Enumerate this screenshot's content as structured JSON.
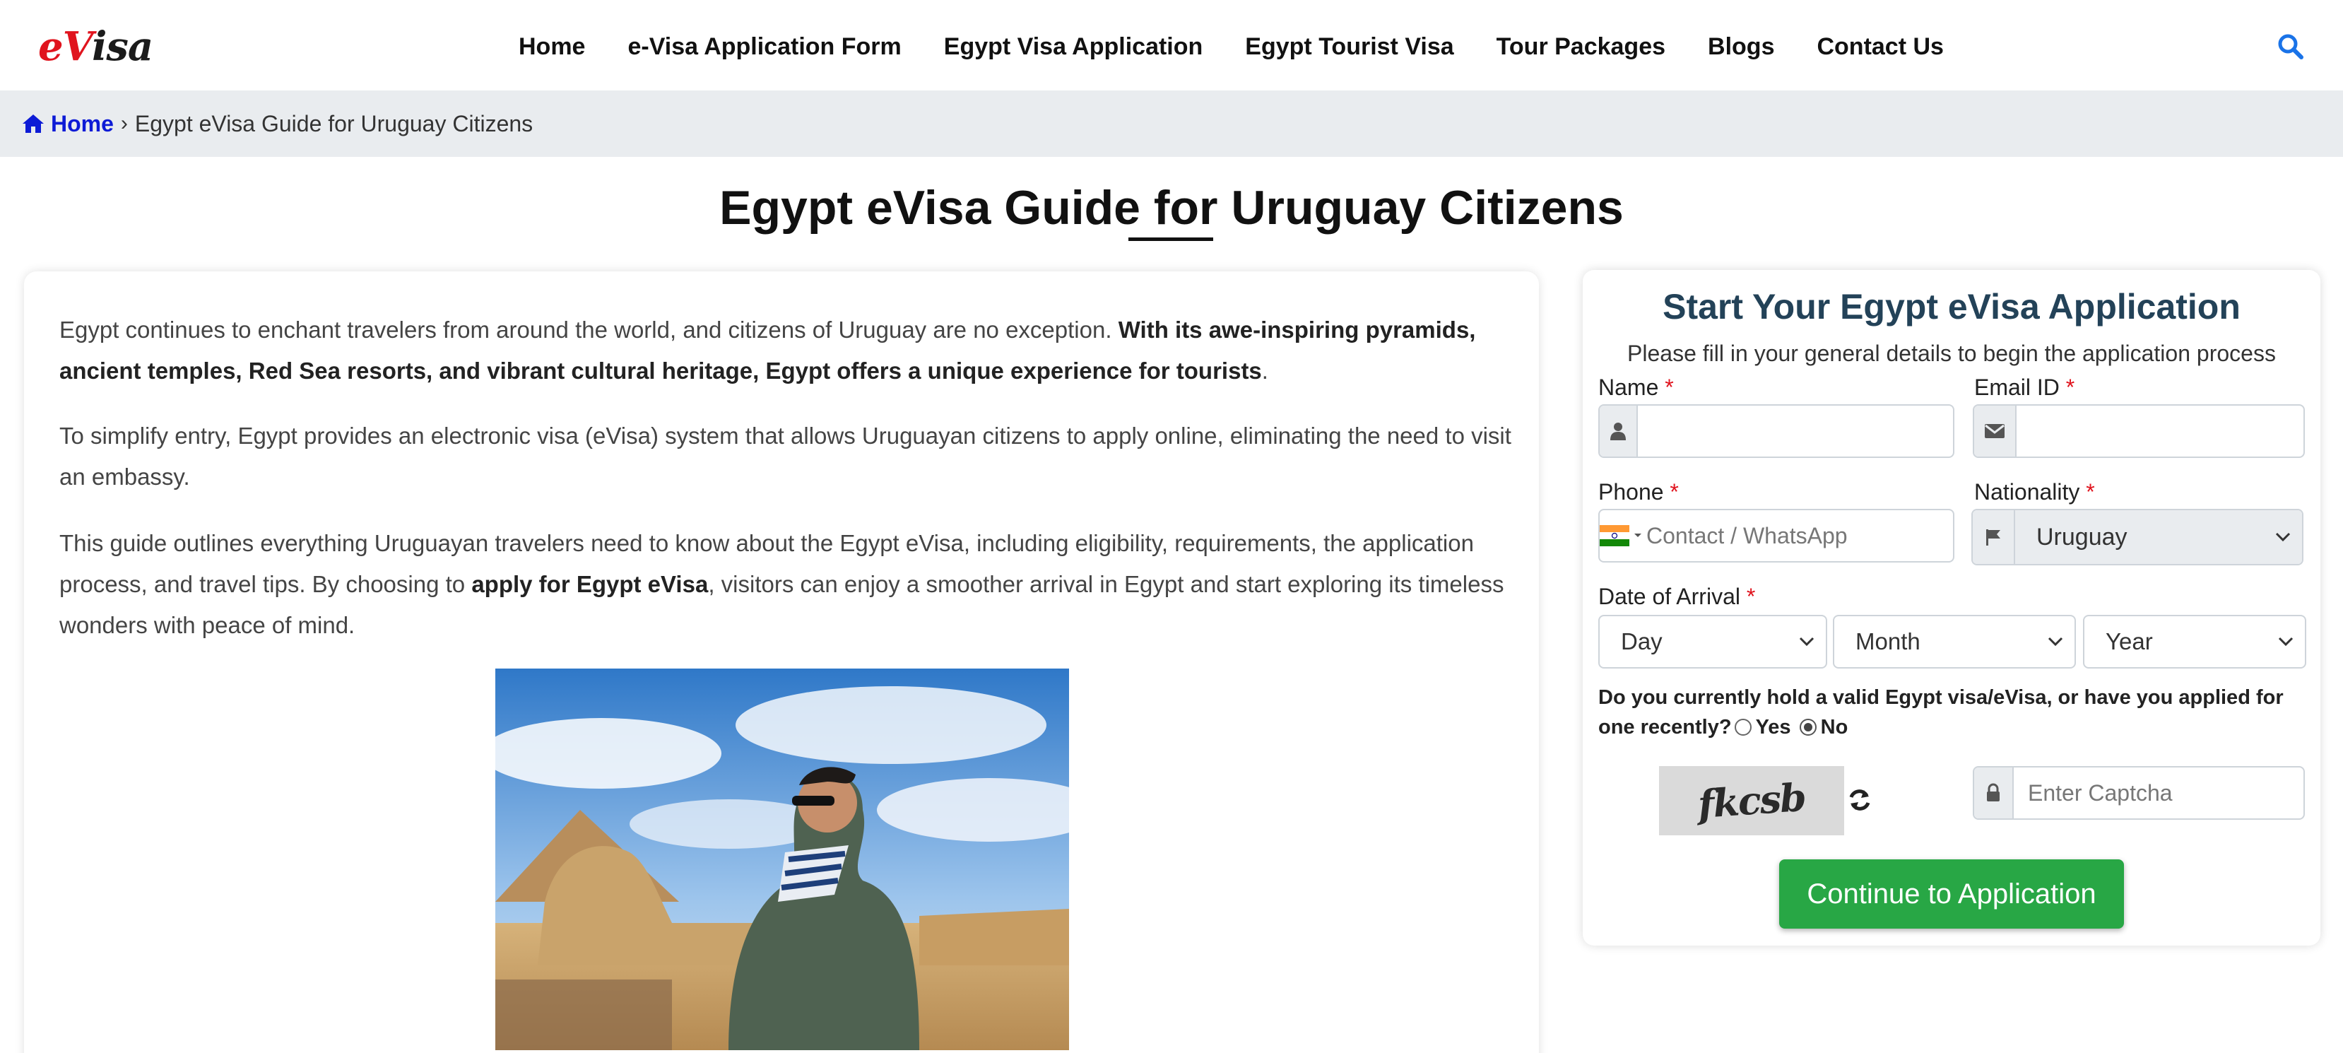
{
  "header": {
    "logo_part1": "eV",
    "logo_part2": "isa",
    "nav": [
      {
        "label": "Home"
      },
      {
        "label": "e-Visa Application Form"
      },
      {
        "label": "Egypt Visa Application"
      },
      {
        "label": "Egypt Tourist Visa"
      },
      {
        "label": "Tour Packages"
      },
      {
        "label": "Blogs"
      },
      {
        "label": "Contact Us"
      }
    ],
    "search_icon": "search-icon"
  },
  "breadcrumb": {
    "home_label": "Home",
    "separator": "›",
    "current": "Egypt eVisa Guide for Uruguay Citizens"
  },
  "page": {
    "title": "Egypt eVisa Guide for Uruguay Citizens"
  },
  "article": {
    "p1_text": "Egypt continues to enchant travelers from around the world, and citizens of Uruguay are no exception. ",
    "p1_bold": "With its awe-inspiring pyramids, ancient temples, Red Sea resorts, and vibrant cultural heritage, Egypt offers a unique experience for tourists",
    "p1_end": ".",
    "p2": "To simplify entry, Egypt provides an electronic visa (eVisa) system that allows Uruguayan citizens to apply online, eliminating the need to visit an embassy.",
    "p3_start": "This guide outlines everything Uruguayan travelers need to know about the Egypt eVisa, including eligibility, requirements, the application process, and travel tips. By choosing to ",
    "p3_bold": "apply for Egypt eVisa",
    "p3_end": ", visitors can enjoy a smoother arrival in Egypt and start exploring its timeless wonders with peace of mind."
  },
  "form": {
    "title": "Start Your Egypt eVisa Application",
    "subtitle": "Please fill in your general details to begin the application process",
    "name_label": "Name",
    "email_label": "Email ID",
    "phone_label": "Phone",
    "phone_placeholder": "Contact / WhatsApp",
    "nationality_label": "Nationality",
    "nationality_value": "Uruguay",
    "arrival_label": "Date of Arrival",
    "day_option": "Day",
    "month_option": "Month",
    "year_option": "Year",
    "question": "Do you currently hold a valid Egypt visa/eVisa, or have you applied for one recently?",
    "yes_label": "Yes",
    "no_label": "No",
    "selected_answer": "No",
    "captcha_text": "fkcsb",
    "captcha_placeholder": "Enter Captcha",
    "submit_label": "Continue to Application",
    "required_mark": "*"
  },
  "colors": {
    "brand_red": "#e0141e",
    "link_blue": "#0d1bd6",
    "submit_green": "#28a745",
    "form_title": "#234258",
    "search_blue": "#1a73e8"
  }
}
